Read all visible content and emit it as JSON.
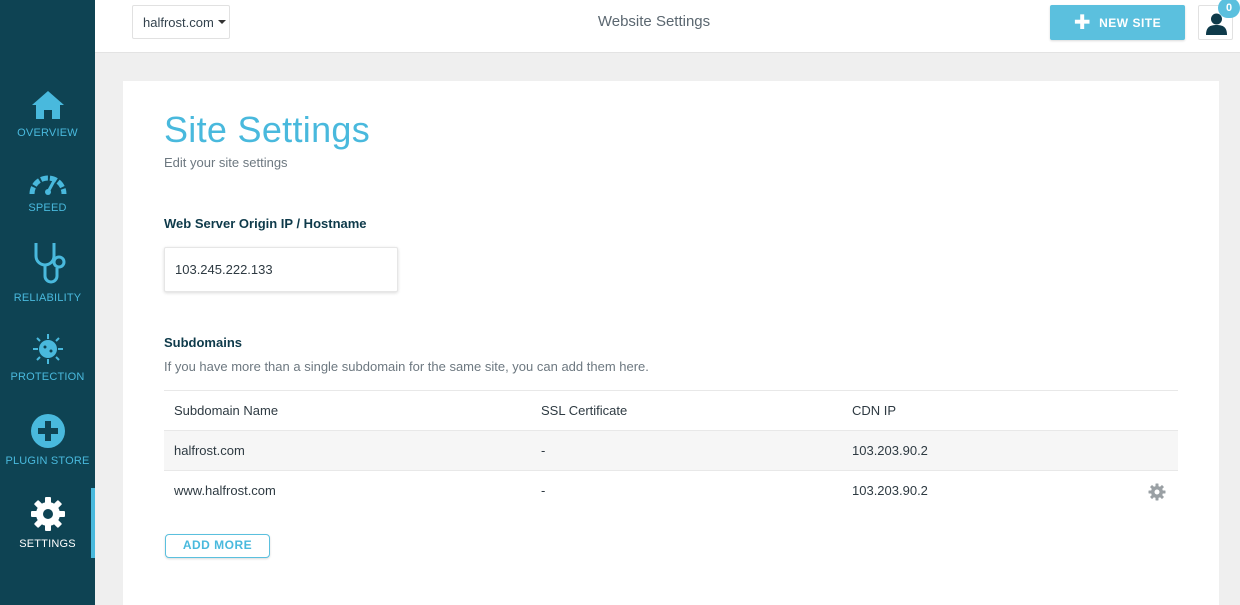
{
  "sidebar": {
    "items": [
      {
        "label": "OVERVIEW",
        "icon": "home-icon"
      },
      {
        "label": "SPEED",
        "icon": "speedometer-icon"
      },
      {
        "label": "RELIABILITY",
        "icon": "stethoscope-icon"
      },
      {
        "label": "PROTECTION",
        "icon": "virus-icon"
      },
      {
        "label": "PLUGIN STORE",
        "icon": "plus-circle-icon"
      },
      {
        "label": "SETTINGS",
        "icon": "gear-icon",
        "active": true
      }
    ]
  },
  "topbar": {
    "site_selector": "halfrost.com",
    "title": "Website Settings",
    "new_site_label": "NEW SITE",
    "notification_count": "0"
  },
  "main": {
    "title": "Site Settings",
    "subtitle": "Edit your site settings",
    "origin": {
      "label": "Web Server Origin IP / Hostname",
      "value": "103.245.222.133"
    },
    "subdomains": {
      "title": "Subdomains",
      "description": "If you have more than a single subdomain for the same site, you can add them here.",
      "columns": [
        "Subdomain Name",
        "SSL Certificate",
        "CDN IP"
      ],
      "rows": [
        {
          "name": "halfrost.com",
          "ssl": "-",
          "cdn_ip": "103.203.90.2"
        },
        {
          "name": "www.halfrost.com",
          "ssl": "-",
          "cdn_ip": "103.203.90.2"
        }
      ],
      "add_more_label": "ADD MORE"
    }
  },
  "colors": {
    "sidebar_bg": "#0e4353",
    "accent": "#49b9dd",
    "button": "#5bc0de"
  }
}
